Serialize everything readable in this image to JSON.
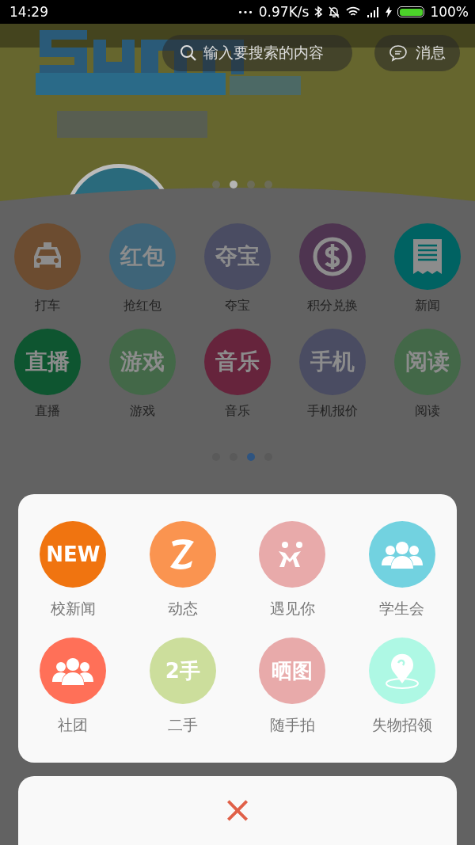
{
  "status_bar": {
    "time": "14:29",
    "dots": "•••",
    "speed": "0.97K/s",
    "battery": "100%"
  },
  "header": {
    "search_placeholder": "输入要搜索的内容",
    "message_button": "消息"
  },
  "banner": {
    "pager": [
      {
        "selected": false
      },
      {
        "selected": true
      },
      {
        "selected": false
      },
      {
        "selected": false
      }
    ]
  },
  "services": {
    "items": [
      {
        "label": "打车",
        "color": "#6c4c30"
      },
      {
        "label": "抢红包",
        "color": "#3e6478",
        "badge": "红包"
      },
      {
        "label": "夺宝",
        "color": "#4a4c62",
        "badge": "夺宝"
      },
      {
        "label": "积分兑换",
        "color": "#4e3450"
      },
      {
        "label": "新闻",
        "color": "#006262"
      },
      {
        "label": "直播",
        "color": "#0e5530",
        "badge": "直播"
      },
      {
        "label": "游戏",
        "color": "#436848",
        "badge": "游戏"
      },
      {
        "label": "音乐",
        "color": "#66243c",
        "badge": "音乐"
      },
      {
        "label": "手机报价",
        "color": "#4a4c62",
        "badge": "手机"
      },
      {
        "label": "阅读",
        "color": "#436848",
        "badge": "阅读"
      }
    ],
    "pager": [
      {
        "selected": false
      },
      {
        "selected": false
      },
      {
        "selected": true
      },
      {
        "selected": false
      }
    ]
  },
  "sheet": {
    "items": [
      {
        "label": "校新闻",
        "color": "#f07410",
        "badge": "NEW"
      },
      {
        "label": "动态",
        "color": "#fa9450"
      },
      {
        "label": "遇见你",
        "color": "#e8aaaa"
      },
      {
        "label": "学生会",
        "color": "#72d2e0"
      },
      {
        "label": "社团",
        "color": "#ff7058"
      },
      {
        "label": "二手",
        "color": "#ccde9c",
        "badge": "2手"
      },
      {
        "label": "随手拍",
        "color": "#e8aaaa",
        "badge": "晒图"
      },
      {
        "label": "失物招领",
        "color": "#aef8e4"
      }
    ],
    "close_label": "×"
  }
}
